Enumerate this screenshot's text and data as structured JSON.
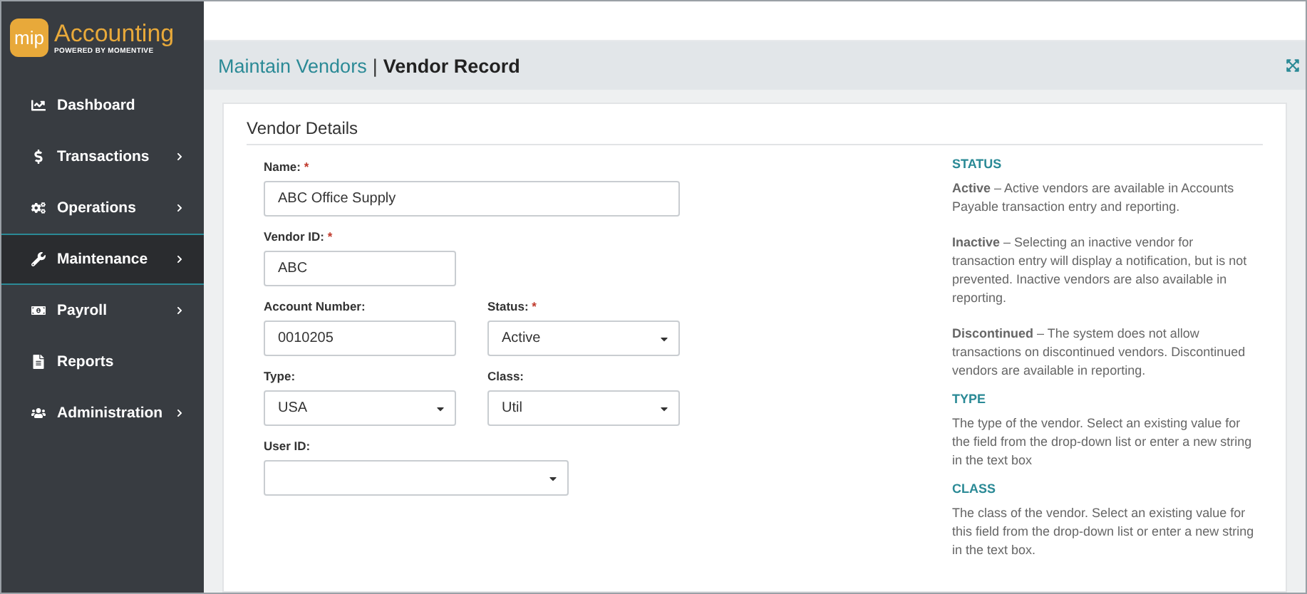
{
  "logo": {
    "badge": "mip",
    "title": "Accounting",
    "tagline": "POWERED BY MOMENTIVE"
  },
  "sidebar": {
    "items": [
      {
        "label": "Dashboard",
        "kind": "chart",
        "selected": false,
        "has_submenu": false
      },
      {
        "label": "Transactions",
        "kind": "dollar",
        "selected": false,
        "has_submenu": true
      },
      {
        "label": "Operations",
        "kind": "gears",
        "selected": false,
        "has_submenu": true
      },
      {
        "label": "Maintenance",
        "kind": "wrench",
        "selected": true,
        "has_submenu": true
      },
      {
        "label": "Payroll",
        "kind": "money",
        "selected": false,
        "has_submenu": true
      },
      {
        "label": "Reports",
        "kind": "file",
        "selected": false,
        "has_submenu": false
      },
      {
        "label": "Administration",
        "kind": "users",
        "selected": false,
        "has_submenu": true
      }
    ]
  },
  "header": {
    "breadcrumb": "Maintain Vendors",
    "separator": "|",
    "title": "Vendor Record"
  },
  "card": {
    "title": "Vendor Details",
    "rows": [
      [
        {
          "label": "Name:",
          "required_mark": "*",
          "kind": "text",
          "value": "ABC Office Supply"
        }
      ],
      [
        {
          "label": "Vendor ID:",
          "required_mark": "*",
          "kind": "text",
          "value": "ABC"
        }
      ],
      [
        {
          "label": "Account Number:",
          "kind": "text",
          "value": "0010205"
        },
        {
          "label": "Status:",
          "required_mark": "*",
          "kind": "select",
          "value": "Active"
        }
      ],
      [
        {
          "label": "Type:",
          "kind": "select",
          "value": "USA"
        },
        {
          "label": "Class:",
          "kind": "select",
          "value": "Util"
        }
      ],
      [
        {
          "label": "User ID:",
          "kind": "select"
        }
      ]
    ],
    "help": [
      {
        "heading": "STATUS",
        "paragraphs": [
          "**Active** – Active vendors are available in Accounts Payable transaction entry and reporting.",
          "**Inactive** – Selecting an inactive vendor for transaction entry will display a notification, but is not prevented. Inactive vendors are also available in reporting.",
          "**Discontinued** – The system does not allow transactions on discontinued vendors. Discontinued vendors are available in reporting."
        ]
      },
      {
        "heading": "TYPE",
        "paragraphs": [
          "The type of the vendor. Select an existing value for the field from the drop-down list or enter a new string in the text box"
        ]
      },
      {
        "heading": "CLASS",
        "paragraphs": [
          "The class of the vendor. Select an existing value for this field from the drop-down list or enter a new string in the text box."
        ]
      }
    ]
  }
}
